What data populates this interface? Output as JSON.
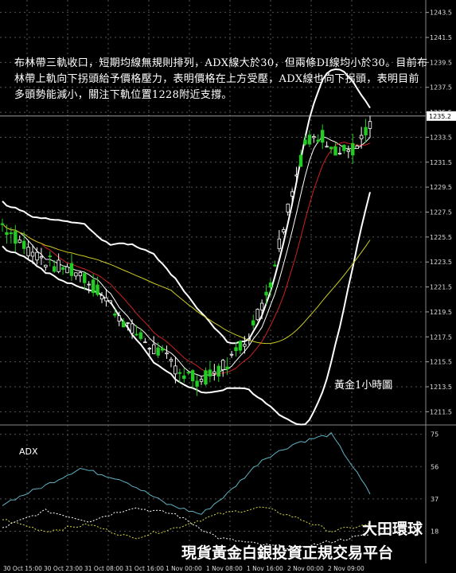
{
  "note": "布林帶三軌收口，短期均線無規則排列，ADX線大於30，但兩條DI線均小於30。目前布林帶上軌向下拐頭給予價格壓力，表明價格在上方受壓，ADX線也向下拐頭，表明目前多頭勢能減小，關注下軌位置1228附近支撐。",
  "chart_title": "黃金1小時圖",
  "adx_label": "ADX",
  "brand_name": "大田環球",
  "brand_slogan": "現貨黃金白銀投資正規交易平台",
  "chart_data": [
    {
      "type": "candlestick",
      "price_ticks": [
        "1243.5",
        "1241.5",
        "1239.5",
        "1237.5",
        "1235.5",
        "1233.5",
        "1231.5",
        "1229.5",
        "1227.5",
        "1225.5",
        "1223.5",
        "1221.5",
        "1219.5",
        "1217.5",
        "1215.5",
        "1213.5",
        "1211.5"
      ],
      "current_price": "1235.2",
      "x_tick_labels": [
        "30 Oct 15:00",
        "30 Oct 23:00",
        "31 Oct 08:00",
        "31 Oct 16:00",
        "1 Nov 00:00",
        "1 Nov 08:00",
        "1 Nov 16:00",
        "2 Nov 00:00",
        "2 Nov 09:00"
      ],
      "grid": true,
      "colors": {
        "candle_up": "#22cc22",
        "candle_down": "#ffffff",
        "bollinger": "#ffffff",
        "ma_fast": "#ffffff",
        "ma_mid": "#cc2222",
        "ma_slow": "#cccc22",
        "grid": "#555555"
      }
    },
    {
      "type": "line",
      "name": "ADX",
      "y_ticks": [
        "75",
        "56",
        "37",
        "18"
      ],
      "colors": {
        "adx": "#5fb3c4",
        "plus_di": "#d8d840",
        "minus_di": "#ffffff"
      }
    }
  ]
}
